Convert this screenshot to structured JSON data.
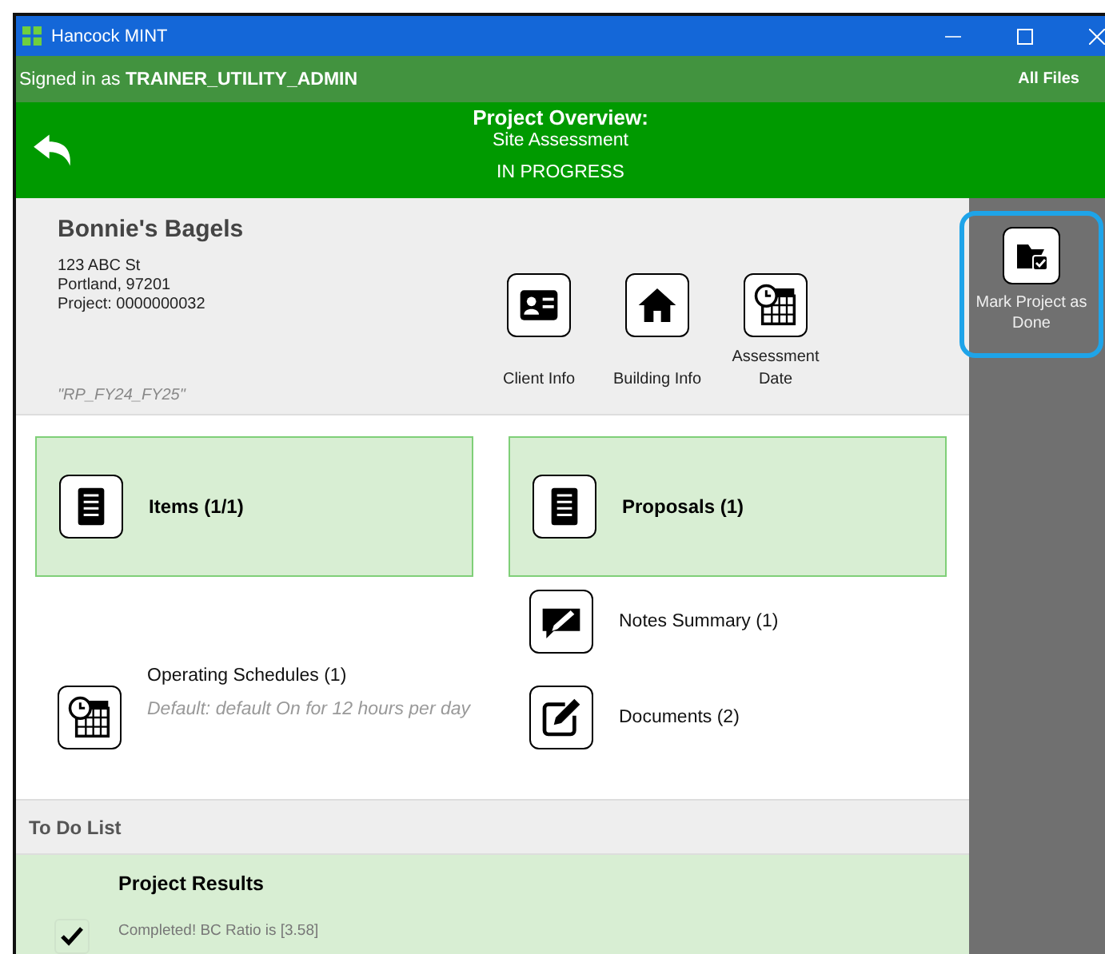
{
  "window": {
    "title": "Hancock MINT"
  },
  "user_bar": {
    "prefix": "Signed in as",
    "user": "TRAINER_UTILITY_ADMIN",
    "link": "All Files"
  },
  "header": {
    "title": "Project Overview:",
    "subtitle": "Site Assessment",
    "status": "IN PROGRESS"
  },
  "project": {
    "name": "Bonnie's Bagels",
    "address_lines": [
      "123 ABC St",
      "Portland, 97201",
      "Project: 0000000032"
    ],
    "tag": "\"RP_FY24_FY25\""
  },
  "quick_actions": [
    {
      "kind": "client",
      "label": "Client Info"
    },
    {
      "kind": "building",
      "label": "Building Info"
    },
    {
      "kind": "date",
      "label": "Assessment Date"
    }
  ],
  "tiles": [
    {
      "label": "Items (1/1)"
    },
    {
      "label": "Proposals (1)"
    }
  ],
  "schedule": {
    "label": "Operating Schedules (1)",
    "detail": "Default: default On for 12 hours per day"
  },
  "links": [
    {
      "kind": "notes",
      "label": "Notes Summary (1)"
    },
    {
      "kind": "documents",
      "label": "Documents (2)"
    }
  ],
  "todo": {
    "title": "To Do List",
    "items": [
      {
        "title": "Project Results",
        "detail": "Completed! BC Ratio is [3.58]",
        "checked": true
      }
    ]
  },
  "side_panel": {
    "action": {
      "label": "Mark Project as Done",
      "highlighted": true
    }
  }
}
